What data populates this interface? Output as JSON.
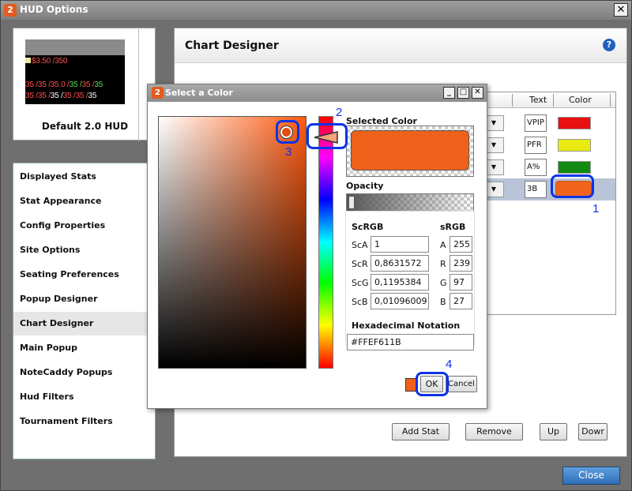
{
  "window": {
    "title": "HUD Options",
    "app_badge": "2",
    "close_glyph": "✕"
  },
  "hud_preview": {
    "line1": [
      {
        "text": "$3.50 /",
        "color": "#ff5050"
      },
      {
        "text": "350",
        "color": "#ff5050"
      }
    ],
    "line2": [
      {
        "text": "35 /",
        "color": "#ff5050"
      },
      {
        "text": "35 /",
        "color": "#ff5050"
      },
      {
        "text": "35.0 /",
        "color": "#ff5050"
      },
      {
        "text": "35 /",
        "color": "#55dd55"
      },
      {
        "text": "35 /",
        "color": "#ff5050"
      },
      {
        "text": "35",
        "color": "#55dd55"
      }
    ],
    "line3": [
      {
        "text": "35 /",
        "color": "#ff5050"
      },
      {
        "text": "35 /",
        "color": "#ff5050"
      },
      {
        "text": "35 /",
        "color": "#ffffff"
      },
      {
        "text": "35 /",
        "color": "#ff5050"
      },
      {
        "text": "35 /",
        "color": "#ff5050"
      },
      {
        "text": "35",
        "color": "#ffffff"
      }
    ],
    "caption": "Default 2.0 HUD"
  },
  "nav": {
    "items": [
      {
        "label": "Displayed Stats"
      },
      {
        "label": "Stat Appearance"
      },
      {
        "label": "Config Properties"
      },
      {
        "label": "Site Options"
      },
      {
        "label": "Seating Preferences"
      },
      {
        "label": "Popup Designer"
      },
      {
        "label": "Chart Designer",
        "selected": true
      },
      {
        "label": "Main Popup"
      },
      {
        "label": "NoteCaddy Popups"
      },
      {
        "label": "Hud Filters"
      },
      {
        "label": "Tournament Filters"
      }
    ]
  },
  "panel": {
    "title": "Chart Designer",
    "help_glyph": "?",
    "grid": {
      "headers": {
        "text": "Text",
        "color": "Color"
      },
      "rows": [
        {
          "text": "VPIP",
          "color": "#e81010"
        },
        {
          "text": "PFR",
          "color": "#e8ea10"
        },
        {
          "text": "A%",
          "color": "#128a12"
        },
        {
          "text": "3B",
          "color": "#f0651b",
          "selected": true
        }
      ],
      "dropdown_glyph": "▼"
    },
    "buttons": {
      "add": "Add Stat",
      "remove": "Remove",
      "up": "Up",
      "down": "Dowr"
    },
    "close": "Close"
  },
  "dialog": {
    "title": "Select a Color",
    "badge": "2",
    "controls": {
      "min": "_",
      "max": "□",
      "close": "✕"
    },
    "selected_color_label": "Selected Color",
    "selected_color": "#ef611b",
    "opacity_label": "Opacity",
    "opacity_value": 1.0,
    "scrgb_label": "ScRGB",
    "srgb_label": "sRGB",
    "scrgb": [
      {
        "label": "ScA",
        "value": "1"
      },
      {
        "label": "ScR",
        "value": "0,8631572"
      },
      {
        "label": "ScG",
        "value": "0,1195384"
      },
      {
        "label": "ScB",
        "value": "0,01096009"
      }
    ],
    "srgb": [
      {
        "label": "A",
        "value": "255"
      },
      {
        "label": "R",
        "value": "239"
      },
      {
        "label": "G",
        "value": "97"
      },
      {
        "label": "B",
        "value": "27"
      }
    ],
    "hex_label": "Hexadecimal Notation",
    "hex_value": "#FFEF611B",
    "ok": "OK",
    "cancel": "Cancel"
  },
  "annotations": {
    "n1": "1",
    "n2": "2",
    "n3": "3",
    "n4": "4",
    "color": "#0b33e8"
  }
}
